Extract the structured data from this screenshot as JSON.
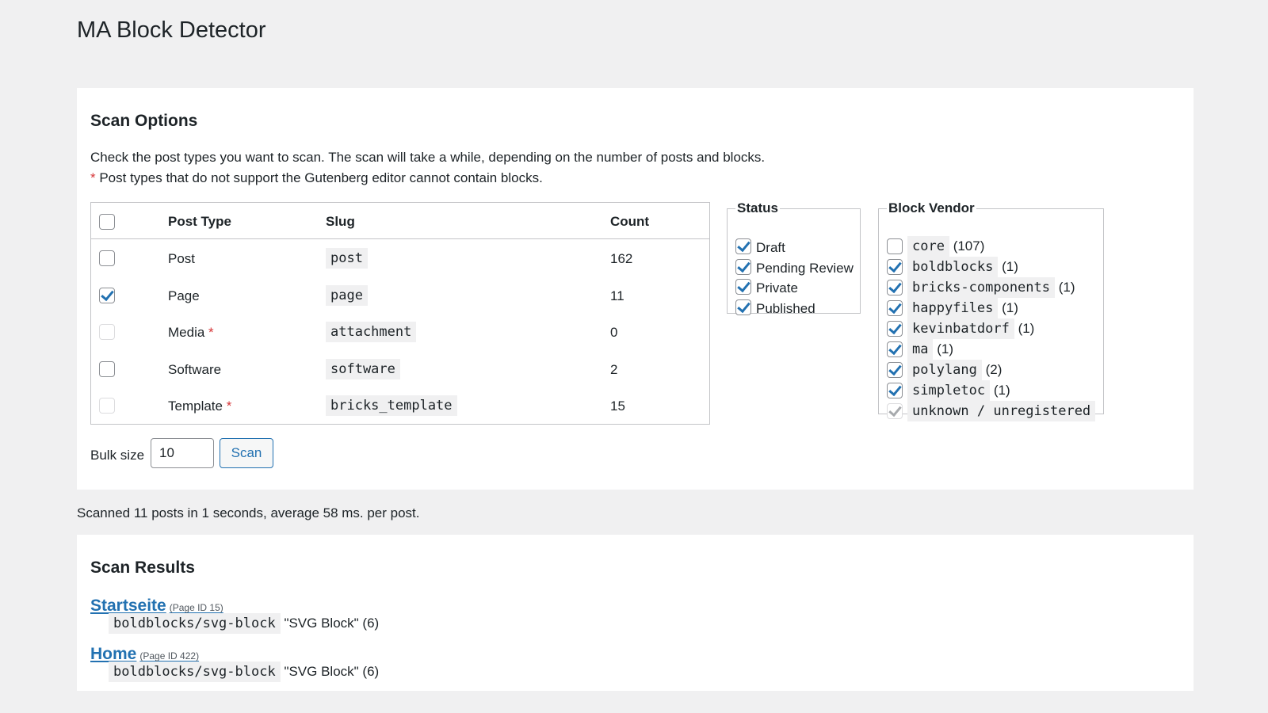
{
  "page_title": "MA Block Detector",
  "scan_options": {
    "heading": "Scan Options",
    "description": "Check the post types you want to scan. The scan will take a while, depending on the number of posts and blocks.",
    "note_marker": "*",
    "note": " Post types that do not support the Gutenberg editor cannot contain blocks.",
    "table": {
      "headers": {
        "post_type": "Post Type",
        "slug": "Slug",
        "count": "Count"
      },
      "rows": [
        {
          "label": "Post",
          "required_marker": "",
          "slug": "post",
          "count": "162",
          "checked": false,
          "disabled": false
        },
        {
          "label": "Page",
          "required_marker": "",
          "slug": "page",
          "count": "11",
          "checked": true,
          "disabled": false
        },
        {
          "label": "Media",
          "required_marker": "*",
          "slug": "attachment",
          "count": "0",
          "checked": false,
          "disabled": true
        },
        {
          "label": "Software",
          "required_marker": "",
          "slug": "software",
          "count": "2",
          "checked": false,
          "disabled": false
        },
        {
          "label": "Template",
          "required_marker": "*",
          "slug": "bricks_template",
          "count": "15",
          "checked": false,
          "disabled": true
        }
      ]
    },
    "status": {
      "legend": "Status",
      "items": [
        {
          "label": "Draft",
          "checked": true
        },
        {
          "label": "Pending Review",
          "checked": true
        },
        {
          "label": "Private",
          "checked": true
        },
        {
          "label": "Published",
          "checked": true
        }
      ]
    },
    "vendor": {
      "legend": "Block Vendor",
      "items": [
        {
          "slug": "core",
          "count": "(107)",
          "checked": false,
          "disabled": false
        },
        {
          "slug": "boldblocks",
          "count": "(1)",
          "checked": true,
          "disabled": false
        },
        {
          "slug": "bricks-components",
          "count": "(1)",
          "checked": true,
          "disabled": false
        },
        {
          "slug": "happyfiles",
          "count": "(1)",
          "checked": true,
          "disabled": false
        },
        {
          "slug": "kevinbatdorf",
          "count": "(1)",
          "checked": true,
          "disabled": false
        },
        {
          "slug": "ma",
          "count": "(1)",
          "checked": true,
          "disabled": false
        },
        {
          "slug": "polylang",
          "count": "(2)",
          "checked": true,
          "disabled": false
        },
        {
          "slug": "simpletoc",
          "count": "(1)",
          "checked": true,
          "disabled": false
        },
        {
          "slug": "unknown / unregistered",
          "count": "",
          "checked": true,
          "disabled": true
        }
      ]
    },
    "bulk_label": "Bulk size",
    "bulk_value": "10",
    "scan_button": "Scan"
  },
  "status_message": "Scanned 11 posts in 1 seconds, average 58 ms. per post.",
  "results": {
    "heading": "Scan Results",
    "items": [
      {
        "title": "Startseite",
        "meta": "(Page ID 15)",
        "block": "boldblocks/svg-block",
        "desc": "\"SVG Block\" (6)"
      },
      {
        "title": "Home",
        "meta": "(Page ID 422)",
        "block": "boldblocks/svg-block",
        "desc": "\"SVG Block\" (6)"
      }
    ]
  },
  "colors": {
    "link": "#2271b1",
    "required": "#d63638",
    "background": "#f0f0f1"
  }
}
